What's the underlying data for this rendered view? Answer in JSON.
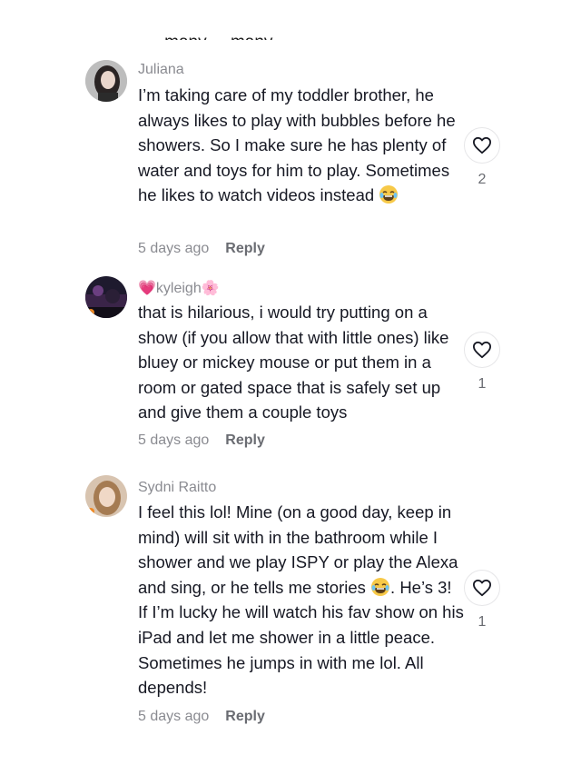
{
  "top_fragment": {
    "text": "... many ... many ..."
  },
  "comments": [
    {
      "username": "Juliana",
      "body_before": "I’m taking care of my toddler brother, he always likes to play with bubbles before he showers. So I make sure he has plenty of water and toys for him to play. Sometimes he likes to watch videos instead ",
      "emoji_after": "😂",
      "body_after": "",
      "time": "5 days ago",
      "reply_label": "Reply",
      "likes": "2",
      "avatar_icon": "profile-photo"
    },
    {
      "username": "kyleigh",
      "username_prefix_emoji": "💗",
      "username_suffix_emoji": "🌸",
      "body_before": "that is hilarious, i would try putting on a show (if you allow that with little ones) like bluey or mickey mouse or put them in a room or gated space that is safely set up and give them a couple toys",
      "time": "5 days ago",
      "reply_label": "Reply",
      "likes": "1",
      "avatar_icon": "halloween-framed-photo"
    },
    {
      "username": "Sydni Raitto",
      "body_before": "I feel this lol! Mine (on a good day, keep in mind) will sit with in the bathroom while I shower and we play ISPY or play the Alexa and sing, or he tells me stories ",
      "emoji_after": "😂",
      "body_after": ". He’s 3! If I’m lucky he will watch his fav show on his iPad and let me shower in a little peace. Sometimes he jumps in with me lol. All depends!",
      "time": "5 days ago",
      "reply_label": "Reply",
      "likes": "1",
      "avatar_icon": "halloween-framed-photo"
    }
  ],
  "colors": {
    "text": "#161823",
    "muted": "#8a8b91",
    "reply": "#6a6c72",
    "like_border": "#e6e6e8"
  },
  "icons": {
    "like": "heart-outline-icon",
    "laugh": "laughing-emoji"
  }
}
